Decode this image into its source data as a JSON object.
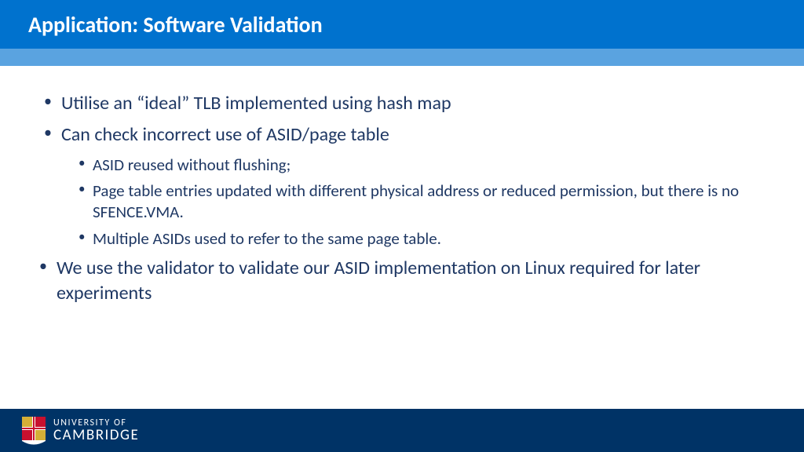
{
  "header": {
    "title": "Application: Software Validation"
  },
  "bullets": {
    "b1": "Utilise an “ideal” TLB implemented using hash map",
    "b2": "Can check incorrect use of ASID/page table",
    "b2_sub": {
      "s1": "ASID reused without flushing;",
      "s2": "Page table entries updated with different physical address or reduced permission, but there is no SFENCE.VMA.",
      "s3": "Multiple ASIDs used to refer to the same page table."
    },
    "b3": "We use the validator to validate our ASID implementation on Linux required for later experiments"
  },
  "footer": {
    "line1": "UNIVERSITY OF",
    "line2": "CAMBRIDGE"
  }
}
